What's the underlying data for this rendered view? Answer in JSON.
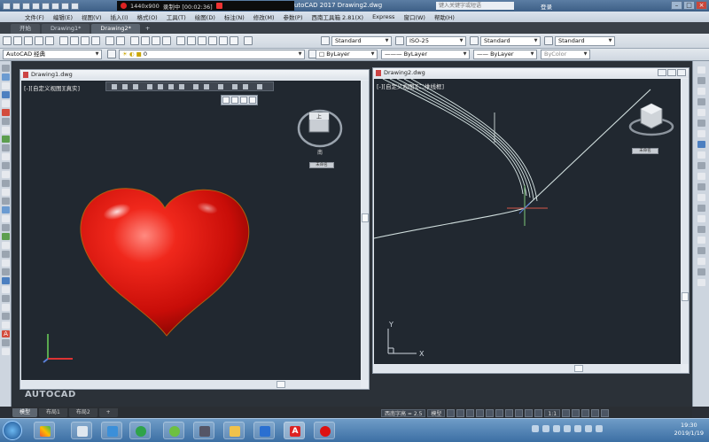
{
  "titlebar": {
    "recorder_resolution": "1440x900",
    "recorder_label": "录制中 [00:02:36]",
    "app_title": "utoCAD 2017   Drawing2.dwg",
    "search_placeholder": "键入关键字或短语",
    "signin": "登录"
  },
  "menu": [
    "文件(F)",
    "编辑(E)",
    "视图(V)",
    "插入(I)",
    "格式(O)",
    "工具(T)",
    "绘图(D)",
    "标注(N)",
    "修改(M)",
    "参数(P)",
    "窗口(W)",
    "帮助(H)",
    "Express",
    "窗口(W)",
    "帮助(H)"
  ],
  "menu_visible": [
    "文件(F)",
    "编辑(E)",
    "视图(V)",
    "插入(I)",
    "格式(O)",
    "工具(T)",
    "绘图(D)",
    "标注(N)",
    "修改(M)",
    "参数(P)",
    "西南工具箱 2.81(X)",
    "Express",
    "窗口(W)",
    "帮助(H)"
  ],
  "tabs": [
    "开始",
    "Drawing1*",
    "Drawing2*",
    "+"
  ],
  "toolbar1": {
    "text_style": "Standard",
    "dim_style": "ISO-25",
    "table_style": "Standard",
    "mleader_style": "Standard"
  },
  "toolbar2": {
    "workspace": "AutoCAD 经典",
    "layer": "0",
    "color": "ByLayer",
    "linetype": "ByLayer",
    "lineweight": "ByLayer",
    "plotstyle": "ByColor"
  },
  "viewports": {
    "left": {
      "title": "Drawing1.dwg",
      "label": "[-][自定义视图][真实]",
      "cube_badge": "未命名",
      "heart_color": "#e11612"
    },
    "right": {
      "title": "Drawing2.dwg",
      "label": "[-][自定义视图][二维线框]",
      "cube_badge": "未命名",
      "axis_x": "X",
      "axis_y": "Y"
    }
  },
  "watermark": "AUTOCAD",
  "watermark2": "AUTOCAD",
  "layout_tabs": [
    "模型",
    "布局1",
    "布局2",
    "+"
  ],
  "status": [
    "西南字高 = 2.5",
    "模型",
    "1:1"
  ],
  "clock": {
    "time": "19:30",
    "date": "2019/1/19"
  }
}
